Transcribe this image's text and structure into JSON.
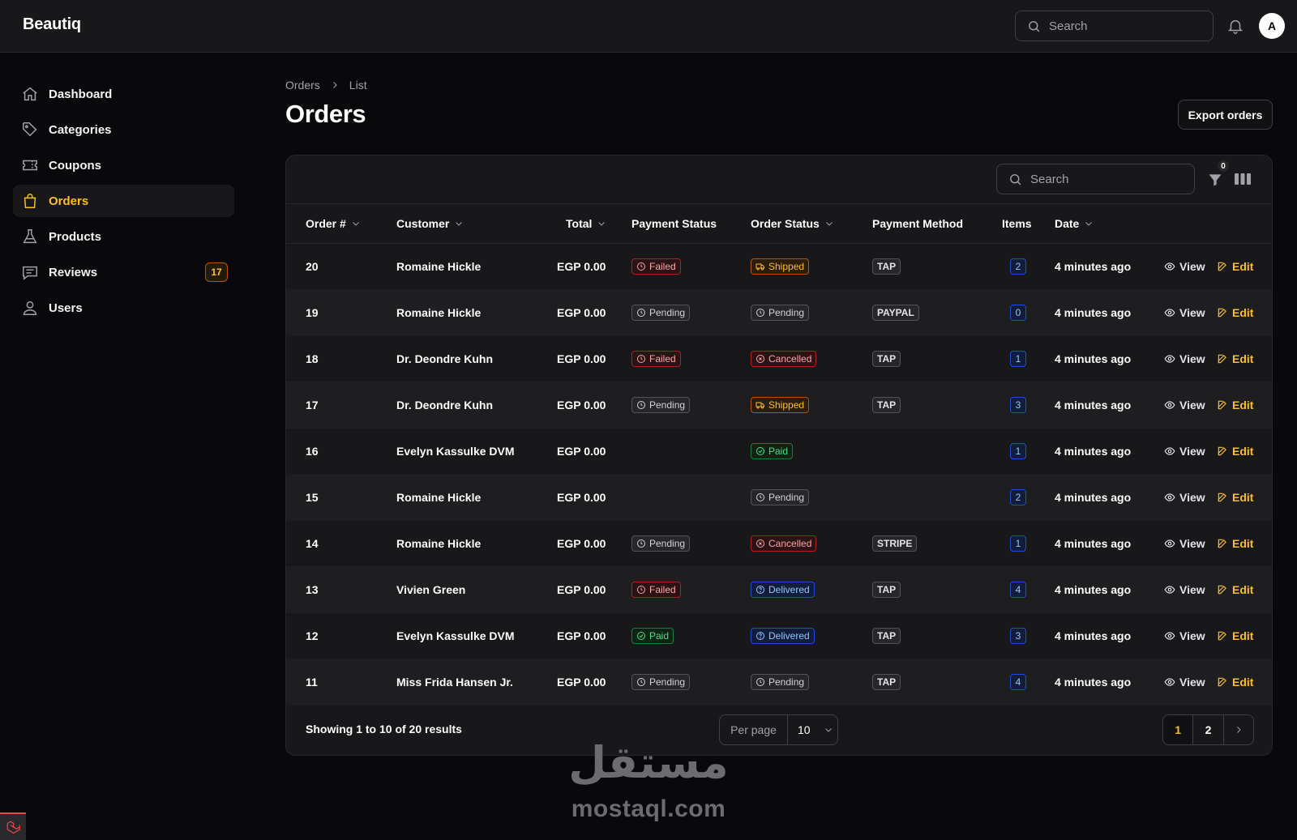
{
  "app": {
    "brand": "Beautiq"
  },
  "topbar": {
    "search_placeholder": "Search",
    "avatar_initial": "A"
  },
  "sidebar": {
    "items": [
      {
        "label": "Dashboard"
      },
      {
        "label": "Categories"
      },
      {
        "label": "Coupons"
      },
      {
        "label": "Orders",
        "active": true
      },
      {
        "label": "Products"
      },
      {
        "label": "Reviews",
        "badge": "17"
      },
      {
        "label": "Users"
      }
    ]
  },
  "breadcrumb": {
    "parent": "Orders",
    "current": "List"
  },
  "page": {
    "title": "Orders",
    "export_label": "Export orders"
  },
  "table": {
    "search_placeholder": "Search",
    "filter_count": "0",
    "headers": {
      "order": "Order #",
      "customer": "Customer",
      "total": "Total",
      "payment_status": "Payment Status",
      "order_status": "Order Status",
      "payment_method": "Payment Method",
      "items": "Items",
      "date": "Date"
    },
    "actions": {
      "view": "View",
      "edit": "Edit"
    },
    "rows": [
      {
        "order": "20",
        "customer": "Romaine Hickle",
        "total": "EGP 0.00",
        "payment_status": "Failed",
        "order_status": "Shipped",
        "payment_method": "TAP",
        "items": "2",
        "date": "4 minutes ago"
      },
      {
        "order": "19",
        "customer": "Romaine Hickle",
        "total": "EGP 0.00",
        "payment_status": "Pending",
        "order_status": "Pending",
        "payment_method": "PAYPAL",
        "items": "0",
        "date": "4 minutes ago"
      },
      {
        "order": "18",
        "customer": "Dr. Deondre Kuhn",
        "total": "EGP 0.00",
        "payment_status": "Failed",
        "order_status": "Cancelled",
        "payment_method": "TAP",
        "items": "1",
        "date": "4 minutes ago"
      },
      {
        "order": "17",
        "customer": "Dr. Deondre Kuhn",
        "total": "EGP 0.00",
        "payment_status": "Pending",
        "order_status": "Shipped",
        "payment_method": "TAP",
        "items": "3",
        "date": "4 minutes ago"
      },
      {
        "order": "16",
        "customer": "Evelyn Kassulke DVM",
        "total": "EGP 0.00",
        "payment_status": "",
        "order_status": "Paid",
        "payment_method": "",
        "items": "1",
        "date": "4 minutes ago"
      },
      {
        "order": "15",
        "customer": "Romaine Hickle",
        "total": "EGP 0.00",
        "payment_status": "",
        "order_status": "Pending",
        "payment_method": "",
        "items": "2",
        "date": "4 minutes ago"
      },
      {
        "order": "14",
        "customer": "Romaine Hickle",
        "total": "EGP 0.00",
        "payment_status": "Pending",
        "order_status": "Cancelled",
        "payment_method": "STRIPE",
        "items": "1",
        "date": "4 minutes ago"
      },
      {
        "order": "13",
        "customer": "Vivien Green",
        "total": "EGP 0.00",
        "payment_status": "Failed",
        "order_status": "Delivered",
        "payment_method": "TAP",
        "items": "4",
        "date": "4 minutes ago"
      },
      {
        "order": "12",
        "customer": "Evelyn Kassulke DVM",
        "total": "EGP 0.00",
        "payment_status": "Paid",
        "order_status": "Delivered",
        "payment_method": "TAP",
        "items": "3",
        "date": "4 minutes ago"
      },
      {
        "order": "11",
        "customer": "Miss Frida Hansen Jr.",
        "total": "EGP 0.00",
        "payment_status": "Pending",
        "order_status": "Pending",
        "payment_method": "TAP",
        "items": "4",
        "date": "4 minutes ago"
      }
    ]
  },
  "footer": {
    "results_text": "Showing 1 to 10 of 20 results",
    "per_page_label": "Per page",
    "per_page_value": "10",
    "pages": [
      "1",
      "2"
    ],
    "current_page": "1"
  },
  "watermark": {
    "arabic": "مستقل",
    "latin": "mostaql.com"
  },
  "colors": {
    "accent": "#fbbf24",
    "background": "#09090b",
    "surface": "#18181b"
  }
}
